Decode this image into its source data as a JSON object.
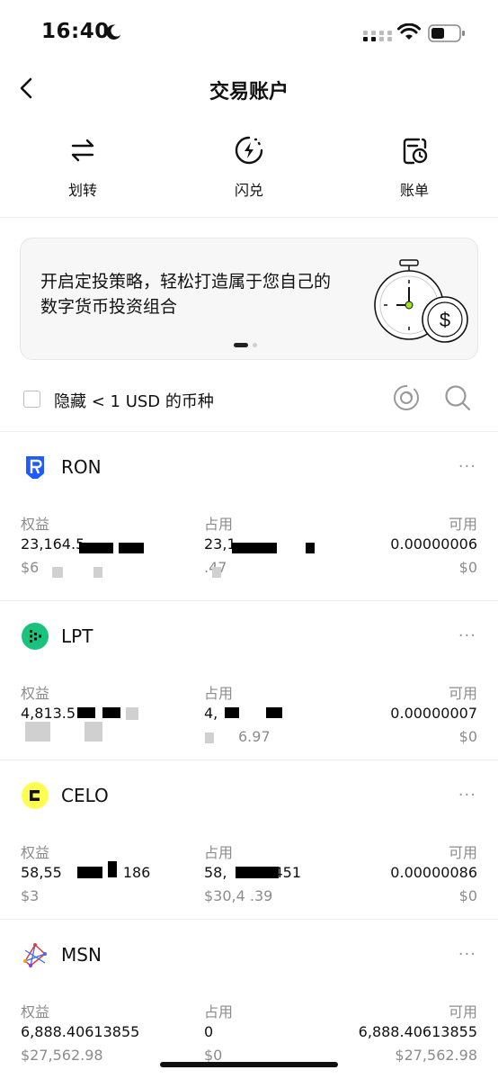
{
  "status_bar": {
    "time": "16:40"
  },
  "nav": {
    "title": "交易账户"
  },
  "actions": [
    {
      "label": "划转",
      "icon": "transfer-icon"
    },
    {
      "label": "闪兑",
      "icon": "flash-convert-icon"
    },
    {
      "label": "账单",
      "icon": "bill-icon"
    }
  ],
  "banner": {
    "text": "开启定投策略，轻松打造属于您自己的数字货币投资组合"
  },
  "filter": {
    "label": "隐藏 < 1 USD 的币种",
    "checked": false
  },
  "assets": [
    {
      "name": "RON",
      "icon_color": "#1f5cff",
      "equity_label": "权益",
      "equity_value": "23,164.5",
      "equity_usd": "$6",
      "used_label": "占用",
      "used_value": "23,1",
      "used_usd": ".47",
      "avail_label": "可用",
      "avail_value": "0.00000006",
      "avail_usd": "$0"
    },
    {
      "name": "LPT",
      "icon_color": "#19c37d",
      "equity_label": "权益",
      "equity_value": "4,813.5",
      "equity_usd": "",
      "used_label": "占用",
      "used_value": "4,",
      "used_usd": "6.97",
      "avail_label": "可用",
      "avail_value": "0.00000007",
      "avail_usd": "$0"
    },
    {
      "name": "CELO",
      "icon_color": "#fcff52",
      "equity_label": "权益",
      "equity_value": "58,55",
      "equity_value_tail": "186",
      "equity_usd": "$3",
      "used_label": "占用",
      "used_value": "58,",
      "used_value_tail": "451",
      "used_usd": "$30,4 .39",
      "avail_label": "可用",
      "avail_value": "0.00000086",
      "avail_usd": "$0"
    },
    {
      "name": "MSN",
      "icon_color": "#e03a3a",
      "equity_label": "权益",
      "equity_value": "6,888.40613855",
      "equity_usd": "$27,562.98",
      "used_label": "占用",
      "used_value": "0",
      "used_usd": "$0",
      "avail_label": "可用",
      "avail_value": "6,888.40613855",
      "avail_usd": "$27,562.98"
    }
  ],
  "more_label": "···"
}
